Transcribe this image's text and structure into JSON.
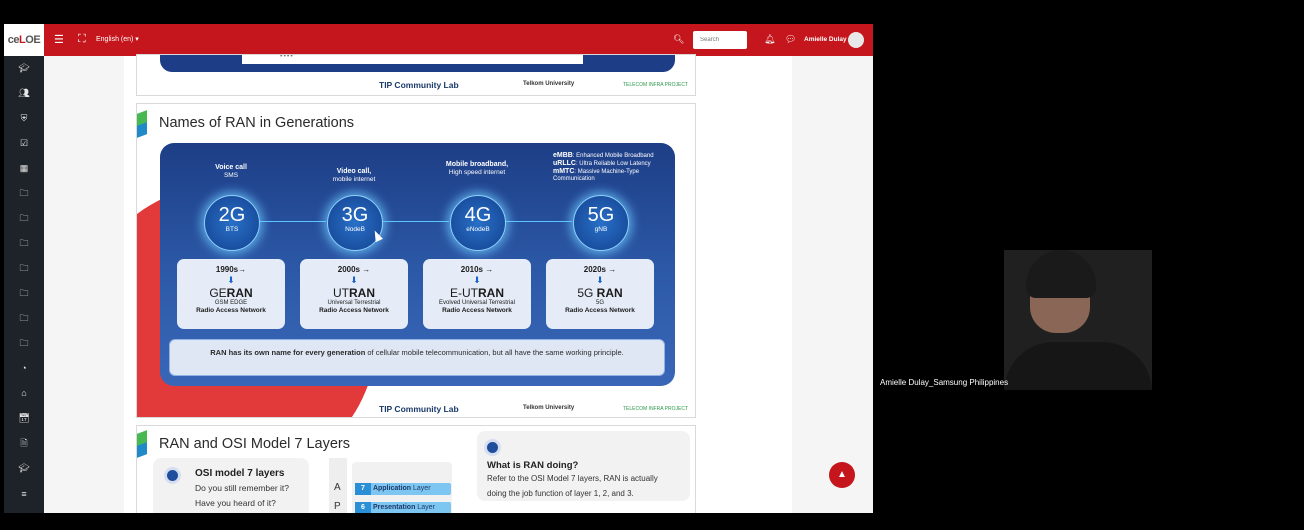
{
  "topbar": {
    "language": "English (en) ▾",
    "search_placeholder": "Search",
    "user_name": "Amielle Dulay"
  },
  "slide_prev": {
    "footer_lab": "TIP Community Lab",
    "footer_telkom": "Telkom University",
    "footer_tip": "TELECOM INFRA PROJECT",
    "dots": "••••"
  },
  "slide_ran": {
    "title": "Names of RAN in Generations",
    "gens": [
      {
        "top_bold": "Voice call",
        "top_sub": "SMS",
        "main": "2G",
        "sub": "BTS",
        "year": "1990s",
        "name_a": "GE",
        "name_b": "RAN",
        "desc": "GSM EDGE",
        "ran": "Radio Access Network"
      },
      {
        "top_bold": "Video call,",
        "top_sub": "mobile internet",
        "main": "3G",
        "sub": "NodeB",
        "year": "2000s",
        "name_a": "UT",
        "name_b": "RAN",
        "desc": "Universal Terrestrial",
        "ran": "Radio Access Network"
      },
      {
        "top_bold": "Mobile broadband,",
        "top_sub": "High speed internet",
        "main": "4G",
        "sub": "eNodeB",
        "year": "2010s",
        "name_a": "E-UT",
        "name_b": "RAN",
        "desc": "Evolved Universal Terrestrial",
        "ran": "Radio Access Network"
      },
      {
        "top_bold": "",
        "top_sub": "",
        "main": "5G",
        "sub": "gNB",
        "year": "2020s",
        "name_a": "5G ",
        "name_b": "RAN",
        "desc": "5G",
        "ran": "Radio Access Network"
      }
    ],
    "fiveg_notes": [
      {
        "k": "eMBB",
        "v": ": Enhanced Mobile Broadband"
      },
      {
        "k": "uRLLC",
        "v": ": Ultra Reliable Low Latency"
      },
      {
        "k": "mMTC",
        "v": ": Massive Machine-Type Communication"
      }
    ],
    "note_bold": "RAN has its own name for every generation",
    "note_rest": " of cellular mobile telecommunication, but all have the same working principle.",
    "footer_lab": "TIP Community Lab",
    "footer_telkom": "Telkom University",
    "footer_tip": "TELECOM INFRA PROJECT"
  },
  "slide_osi": {
    "title": "RAN and OSI Model 7 Layers",
    "osi_heading": "OSI model  7 layers",
    "osi_q1": "Do you still remember it?",
    "osi_q2": "Have you heard of it?",
    "letters": [
      "A",
      "P"
    ],
    "layers": [
      {
        "num": "7",
        "name": "Application",
        "suffix": " Layer"
      },
      {
        "num": "6",
        "name": "Presentation",
        "suffix": " Layer"
      }
    ],
    "ran_heading": "What is RAN doing?",
    "ran_text1": "Refer to the OSI Model 7 layers, RAN is actually",
    "ran_text2": "doing the job function of layer 1, 2, and 3."
  },
  "video": {
    "label": "Amielle Dulay_Samsung Philippines"
  },
  "colors": {
    "brand_red": "#c4161c",
    "sidebar": "#1e2329",
    "diagram_blue": "#1d3e86"
  }
}
